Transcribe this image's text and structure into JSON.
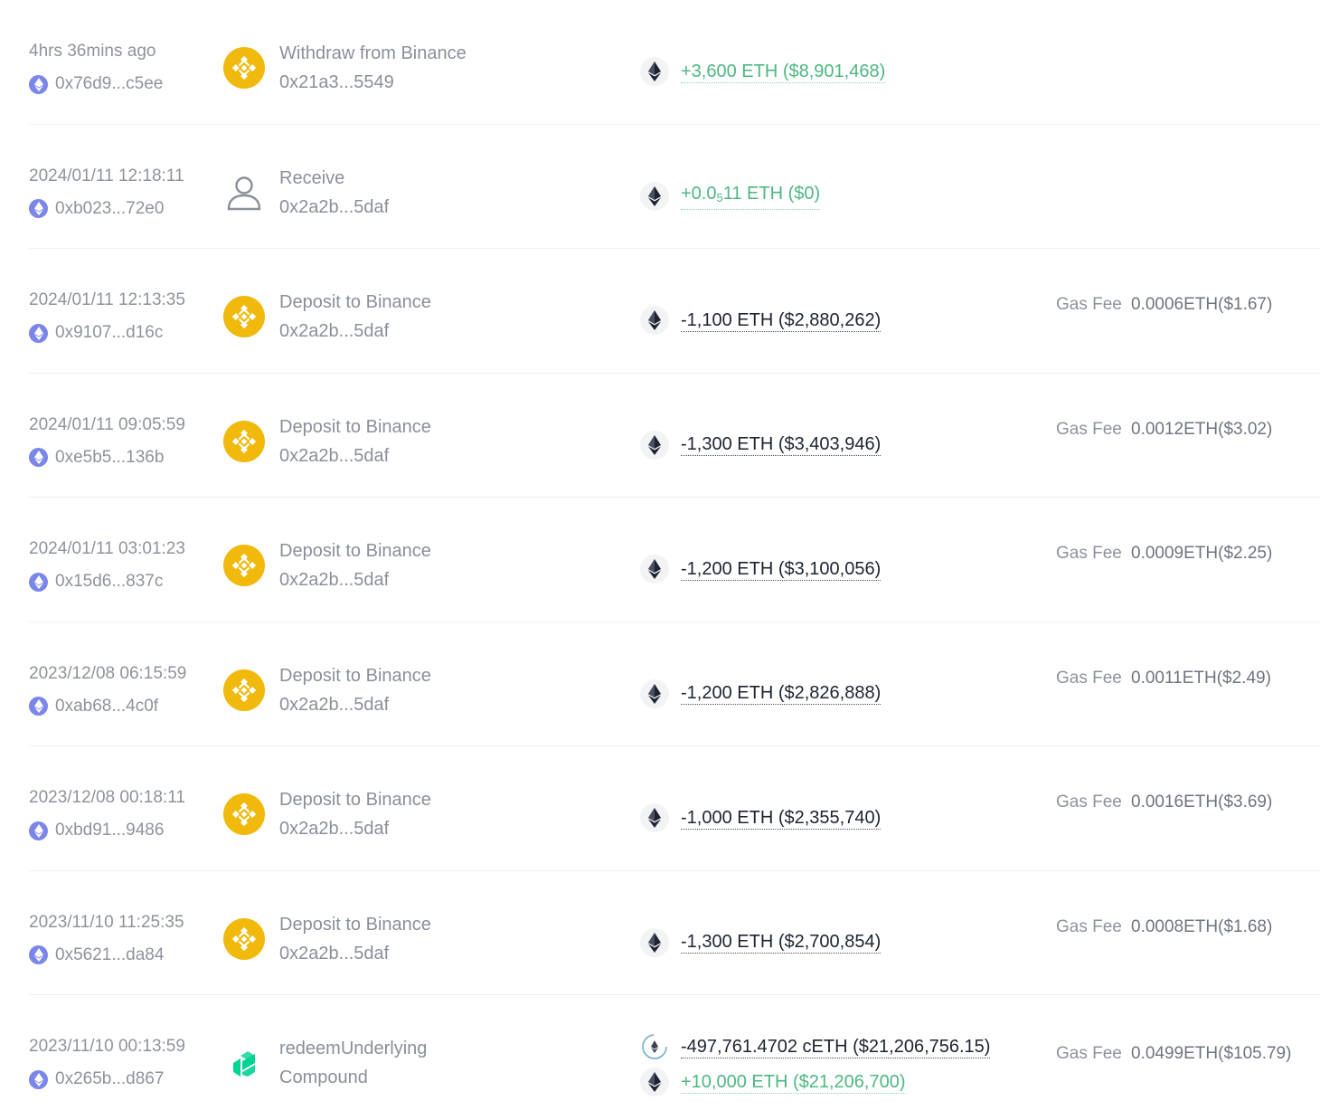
{
  "colors": {
    "positive": "#4cb781",
    "negative": "#1d2330",
    "binance": "#f0b90b",
    "compound": "#00d395",
    "eth_badge": "#7b86ea"
  },
  "gas_label": "Gas Fee",
  "rows": [
    {
      "time": "4hrs 36mins ago",
      "hash": "0x76d9...c5ee",
      "icon": "binance-icon",
      "action": "Withdraw from Binance",
      "address": "0x21a3...5549",
      "amounts": [
        {
          "text": "+3,600 ETH ($8,901,468)",
          "sign": "pos",
          "token": "eth-icon"
        }
      ],
      "gas": ""
    },
    {
      "time": "2024/01/11 12:18:11",
      "hash": "0xb023...72e0",
      "icon": "user-icon",
      "action": "Receive",
      "address": "0x2a2b...5daf",
      "amounts": [
        {
          "pre": "+0.0",
          "sub": "5",
          "post": "11 ETH ($0)",
          "sign": "pos",
          "token": "eth-icon"
        }
      ],
      "gas": ""
    },
    {
      "time": "2024/01/11 12:13:35",
      "hash": "0x9107...d16c",
      "icon": "binance-icon",
      "action": "Deposit to Binance",
      "address": "0x2a2b...5daf",
      "amounts": [
        {
          "text": "-1,100 ETH ($2,880,262)",
          "sign": "neg",
          "token": "eth-icon"
        }
      ],
      "gas": "0.0006ETH($1.67)"
    },
    {
      "time": "2024/01/11 09:05:59",
      "hash": "0xe5b5...136b",
      "icon": "binance-icon",
      "action": "Deposit to Binance",
      "address": "0x2a2b...5daf",
      "amounts": [
        {
          "text": "-1,300 ETH ($3,403,946)",
          "sign": "neg",
          "token": "eth-icon"
        }
      ],
      "gas": "0.0012ETH($3.02)"
    },
    {
      "time": "2024/01/11 03:01:23",
      "hash": "0x15d6...837c",
      "icon": "binance-icon",
      "action": "Deposit to Binance",
      "address": "0x2a2b...5daf",
      "amounts": [
        {
          "text": "-1,200 ETH ($3,100,056)",
          "sign": "neg",
          "token": "eth-icon"
        }
      ],
      "gas": "0.0009ETH($2.25)"
    },
    {
      "time": "2023/12/08 06:15:59",
      "hash": "0xab68...4c0f",
      "icon": "binance-icon",
      "action": "Deposit to Binance",
      "address": "0x2a2b...5daf",
      "amounts": [
        {
          "text": "-1,200 ETH ($2,826,888)",
          "sign": "neg",
          "token": "eth-icon"
        }
      ],
      "gas": "0.0011ETH($2.49)"
    },
    {
      "time": "2023/12/08 00:18:11",
      "hash": "0xbd91...9486",
      "icon": "binance-icon",
      "action": "Deposit to Binance",
      "address": "0x2a2b...5daf",
      "amounts": [
        {
          "text": "-1,000 ETH ($2,355,740)",
          "sign": "neg",
          "token": "eth-icon"
        }
      ],
      "gas": "0.0016ETH($3.69)"
    },
    {
      "time": "2023/11/10 11:25:35",
      "hash": "0x5621...da84",
      "icon": "binance-icon",
      "action": "Deposit to Binance",
      "address": "0x2a2b...5daf",
      "amounts": [
        {
          "text": "-1,300 ETH ($2,700,854)",
          "sign": "neg",
          "token": "eth-icon"
        }
      ],
      "gas": "0.0008ETH($1.68)"
    },
    {
      "time": "2023/11/10 00:13:59",
      "hash": "0x265b...d867",
      "icon": "compound-icon",
      "action": "redeemUnderlying",
      "address": "Compound",
      "amounts": [
        {
          "text": "-497,761.4702 cETH ($21,206,756.15)",
          "sign": "neg",
          "token": "ceth-icon"
        },
        {
          "text": "+10,000 ETH ($21,206,700)",
          "sign": "pos",
          "token": "eth-icon"
        }
      ],
      "gas": "0.0499ETH($105.79)"
    }
  ]
}
